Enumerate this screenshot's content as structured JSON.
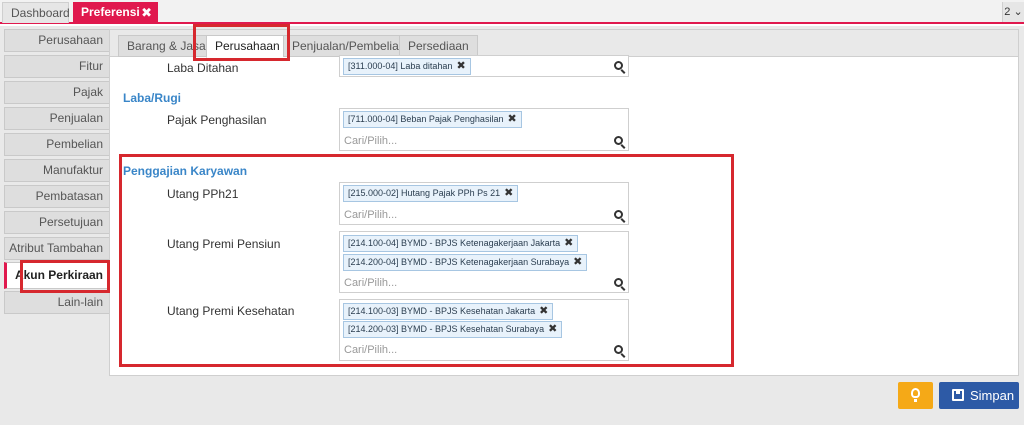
{
  "top_tabs": {
    "dashboard": "Dashboard",
    "preferensi": "Preferensi",
    "close": "✖",
    "right_indicator": "2 ⌄"
  },
  "sidebar": {
    "items": [
      {
        "label": "Perusahaan"
      },
      {
        "label": "Fitur"
      },
      {
        "label": "Pajak"
      },
      {
        "label": "Penjualan"
      },
      {
        "label": "Pembelian"
      },
      {
        "label": "Manufaktur"
      },
      {
        "label": "Pembatasan"
      },
      {
        "label": "Persetujuan"
      },
      {
        "label": "Atribut Tambahan"
      },
      {
        "label": "Akun Perkiraan"
      },
      {
        "label": "Lain-lain"
      }
    ],
    "active_index": 9
  },
  "inner_tabs": [
    "Barang & Jasa",
    "Perusahaan",
    "Penjualan/Pembelian",
    "Persediaan"
  ],
  "form": {
    "laba_ditahan": {
      "label": "Laba Ditahan",
      "chips": [
        "[311.000-04] Laba ditahan"
      ]
    },
    "section_laba_rugi": "Laba/Rugi",
    "pajak_penghasilan": {
      "label": "Pajak Penghasilan",
      "chips": [
        "[711.000-04] Beban Pajak Penghasilan"
      ],
      "placeholder": "Cari/Pilih..."
    },
    "section_penggajian": "Penggajian Karyawan",
    "utang_pph21": {
      "label": "Utang PPh21",
      "chips": [
        "[215.000-02] Hutang Pajak PPh Ps 21"
      ],
      "placeholder": "Cari/Pilih..."
    },
    "utang_premi_pensiun": {
      "label": "Utang Premi Pensiun",
      "chips": [
        "[214.100-04] BYMD - BPJS Ketenagakerjaan Jakarta",
        "[214.200-04] BYMD - BPJS Ketenagakerjaan Surabaya"
      ],
      "placeholder": "Cari/Pilih..."
    },
    "utang_premi_kesehatan": {
      "label": "Utang Premi Kesehatan",
      "chips": [
        "[214.100-03] BYMD - BPJS Kesehatan Jakarta",
        "[214.200-03] BYMD - BPJS Kesehatan Surabaya"
      ],
      "placeholder": "Cari/Pilih..."
    },
    "chip_remove": "✖"
  },
  "buttons": {
    "save": "Simpan",
    "tips_icon": "lightbulb-icon"
  },
  "colors": {
    "accent": "#e0194e",
    "section": "#3a86c8",
    "save": "#2d5aa6",
    "tips": "#f5a917",
    "highlight": "#d6282e"
  }
}
